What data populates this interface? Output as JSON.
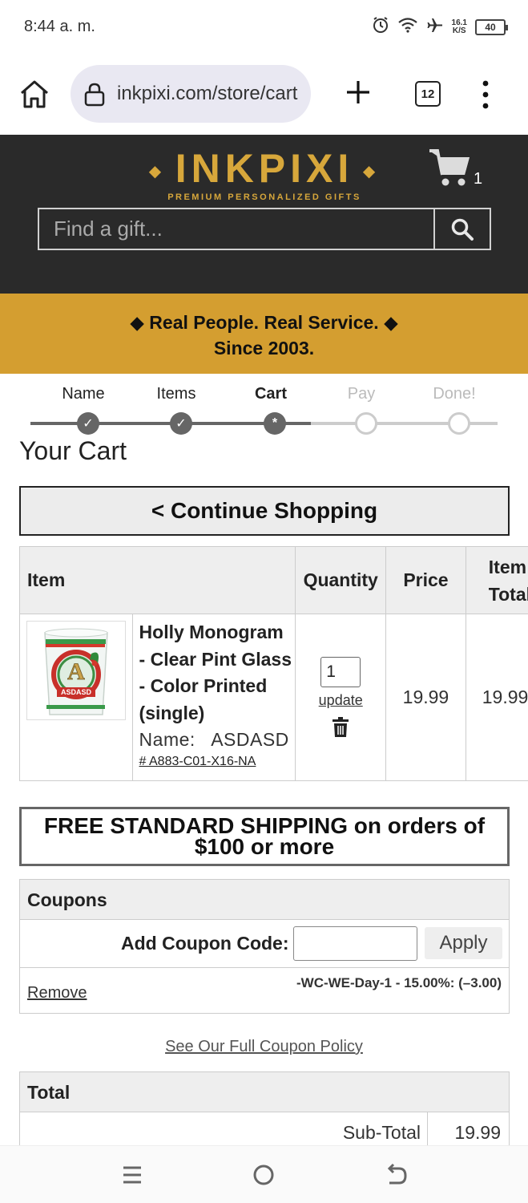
{
  "status_bar": {
    "time": "8:44 a. m.",
    "net_speed_top": "16.1",
    "net_speed_bottom": "K/S",
    "battery": "40"
  },
  "browser": {
    "url": "inkpixi.com/store/cart",
    "tab_count": "12"
  },
  "header": {
    "logo_main": "INKPIXI",
    "logo_sub": "PREMIUM PERSONALIZED GIFTS",
    "cart_count": "1",
    "search_placeholder": "Find a gift..."
  },
  "promo": {
    "line1": "◆  Real People.  Real Service.  ◆",
    "line2": "Since 2003."
  },
  "steps": [
    {
      "label": "Name",
      "state": "done",
      "mark": "✓"
    },
    {
      "label": "Items",
      "state": "done",
      "mark": "✓"
    },
    {
      "label": "Cart",
      "state": "current",
      "mark": "*"
    },
    {
      "label": "Pay",
      "state": "future",
      "mark": ""
    },
    {
      "label": "Done!",
      "state": "future",
      "mark": ""
    }
  ],
  "cart": {
    "title": "Your Cart",
    "continue_label": "< Continue Shopping",
    "columns": {
      "item": "Item",
      "quantity": "Quantity",
      "price": "Price",
      "item_total_1": "Item",
      "item_total_2": "Total"
    },
    "items": [
      {
        "name": "Holly Monogram - Clear Pint Glass - Color Printed (single)",
        "option_label": "Name:",
        "option_value": "ASDASD",
        "sku": "# A883-C01-X16-NA",
        "quantity": "1",
        "update_label": "update",
        "price": "19.99",
        "total": "19.99",
        "image_monogram": "A",
        "image_name": "ASDASD"
      }
    ]
  },
  "shipping_notice": "FREE STANDARD SHIPPING on orders of $100 or more",
  "coupons": {
    "heading": "Coupons",
    "add_label": "Add Coupon Code:",
    "input_value": "",
    "apply_label": "Apply",
    "remove_label": "Remove",
    "applied_code": "-WC-WE-Day-1 - 15.00%: (–3.00)"
  },
  "policy_link": "See Our Full Coupon Policy",
  "totals": {
    "heading": "Total",
    "subtotal_label": "Sub-Total",
    "subtotal_value": "19.99"
  },
  "colors": {
    "header_bg": "#2a2a2a",
    "brand_gold": "#d7a73b",
    "promo_bg": "#d49e30"
  }
}
